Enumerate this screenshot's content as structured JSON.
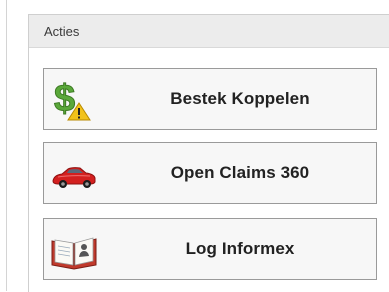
{
  "panel": {
    "title": "Acties"
  },
  "actions": [
    {
      "label": "Bestek Koppelen",
      "icon": "dollar-warning-icon"
    },
    {
      "label": "Open Claims 360",
      "icon": "red-car-icon"
    },
    {
      "label": "Log Informex",
      "icon": "logbook-icon"
    }
  ],
  "colors": {
    "header_bg": "#ececec",
    "button_bg": "#f7f7f7",
    "button_border": "#9a9a9a",
    "dollar_green": "#5aa83a",
    "warning_yellow": "#f2c21a",
    "car_red": "#d3201f"
  }
}
